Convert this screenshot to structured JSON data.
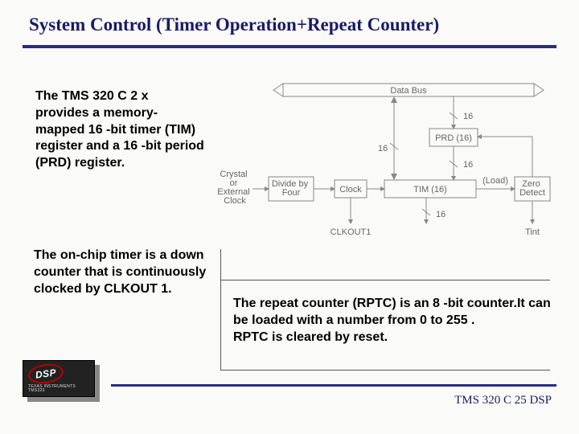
{
  "title": "System Control (Timer Operation+Repeat Counter)",
  "paragraph1": "The TMS 320 C 2 x provides a memory-mapped 16 -bit timer (TIM) register and a 16 -bit period (PRD) register.",
  "paragraph2": " The on-chip timer is a down counter that is continuously clocked by CLKOUT 1.",
  "paragraph3": "The repeat counter (RPTC) is an 8 -bit counter.It can be loaded with a number from 0 to 255 .\n RPTC is cleared by reset.",
  "footer": "TMS 320 C 25 DSP",
  "logo": {
    "label": "DSP",
    "sub1": "TEXAS INSTRUMENTS",
    "sub2": "TMS320"
  },
  "diagram": {
    "bus_label": "Data Bus",
    "bits_upper": "16",
    "bits_mid_left": "16",
    "bits_mid_right": "16",
    "bits_lower": "16",
    "input_label": "Crystal\nor\nExternal\nClock",
    "block_divide": "Divide by\nFour",
    "block_clock": "Clock",
    "block_prd": "PRD (16)",
    "block_tim": "TIM (16)",
    "label_load": "(Load)",
    "block_zero": "Zero\nDetect",
    "out_clkout": "CLKOUT1",
    "out_tint": "Tint"
  }
}
